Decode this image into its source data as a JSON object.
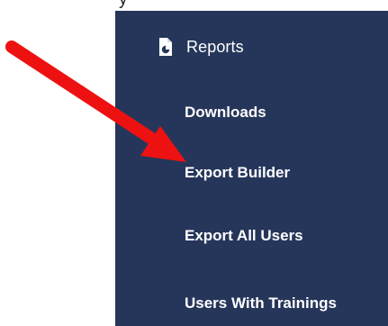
{
  "top_partial_text": "y",
  "sidebar": {
    "header": {
      "icon": "report-file-icon",
      "label": "Reports"
    },
    "items": [
      {
        "label": "Downloads"
      },
      {
        "label": "Export Builder"
      },
      {
        "label": "Export All Users"
      },
      {
        "label": "Users With Trainings"
      }
    ]
  },
  "annotation": {
    "icon": "red-arrow-icon",
    "color": "#ee1111"
  },
  "colors": {
    "sidebar_bg": "#26365a",
    "text": "#ffffff",
    "arrow": "#ee1111"
  }
}
